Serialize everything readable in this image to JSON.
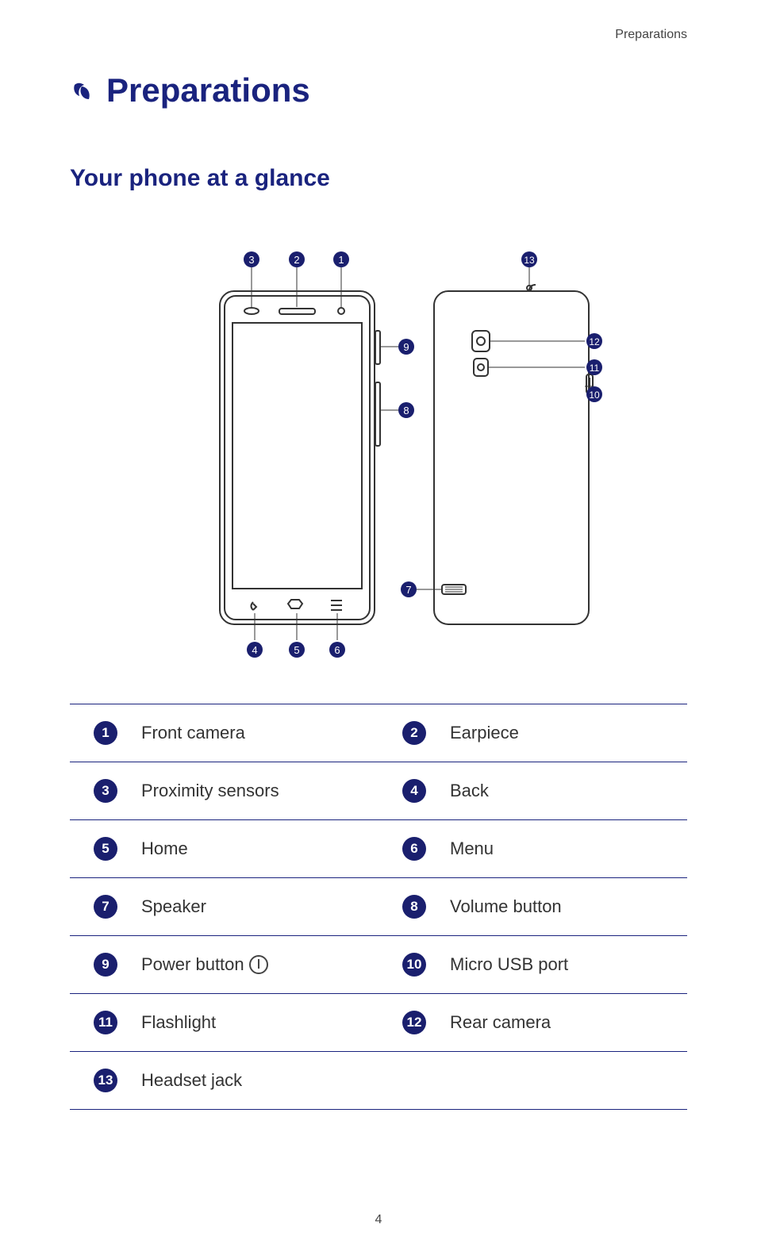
{
  "header": {
    "section": "Preparations"
  },
  "chapter": {
    "title": "Preparations"
  },
  "section": {
    "title": "Your phone at a glance"
  },
  "legend": {
    "items": [
      {
        "n": "1",
        "label": "Front camera"
      },
      {
        "n": "2",
        "label": "Earpiece"
      },
      {
        "n": "3",
        "label": "Proximity sensors"
      },
      {
        "n": "4",
        "label": "Back"
      },
      {
        "n": "5",
        "label": "Home"
      },
      {
        "n": "6",
        "label": "Menu"
      },
      {
        "n": "7",
        "label": "Speaker"
      },
      {
        "n": "8",
        "label": "Volume button"
      },
      {
        "n": "9",
        "label": "Power button",
        "has_power_icon": true
      },
      {
        "n": "10",
        "label": "Micro USB port"
      },
      {
        "n": "11",
        "label": "Flashlight"
      },
      {
        "n": "12",
        "label": "Rear camera"
      },
      {
        "n": "13",
        "label": "Headset jack"
      }
    ]
  },
  "diagram": {
    "callouts": {
      "front_top": [
        "3",
        "2",
        "1"
      ],
      "front_right": [
        "9",
        "8"
      ],
      "front_bottom": [
        "4",
        "5",
        "6"
      ],
      "back_top": [
        "13"
      ],
      "back_right": [
        "12",
        "11",
        "10"
      ],
      "mid_left": [
        "7"
      ]
    }
  },
  "pageNumber": "4"
}
